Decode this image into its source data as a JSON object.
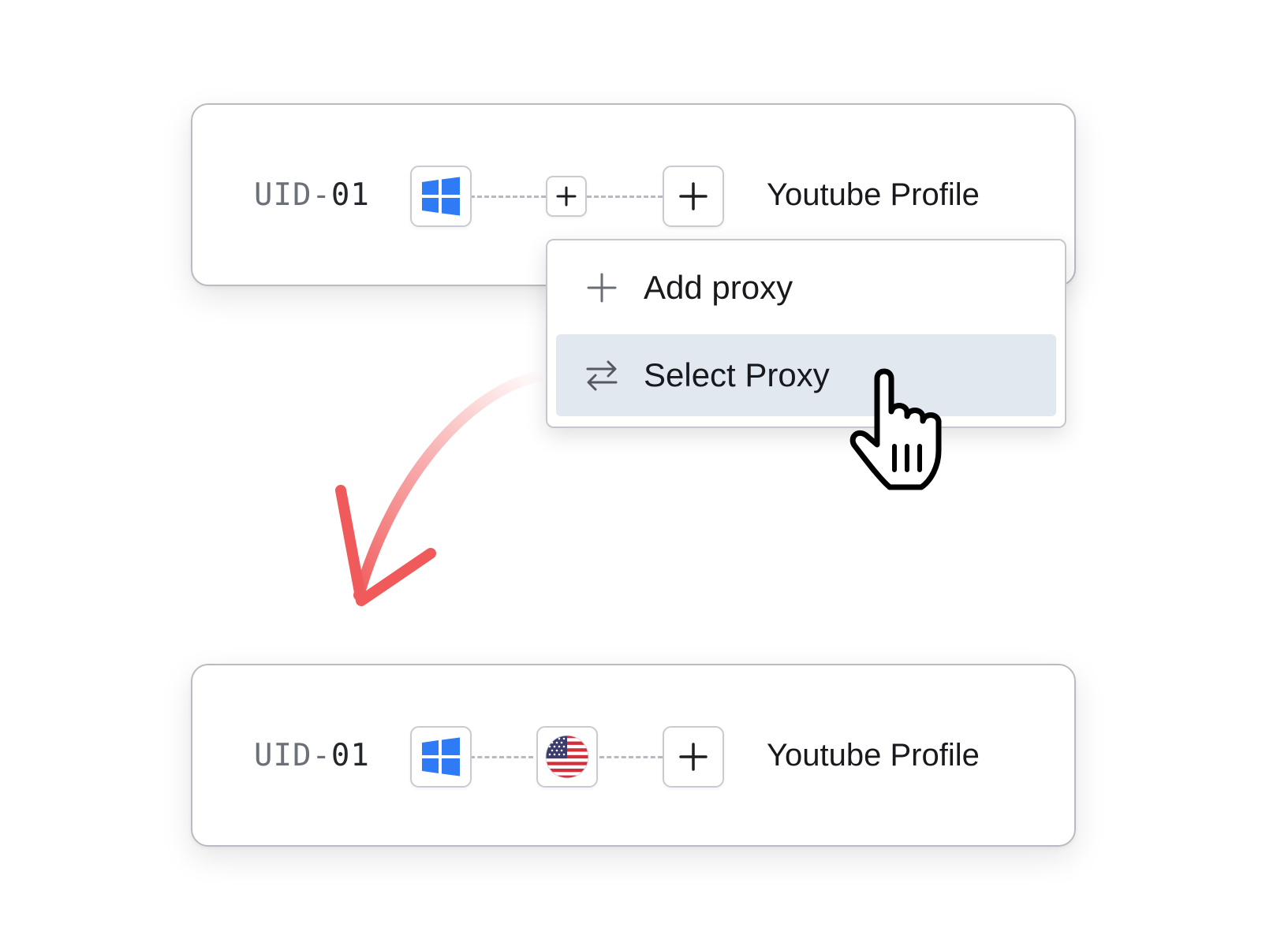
{
  "top_card": {
    "uid_prefix": "UID-",
    "uid_number": "01",
    "os_icon": "windows-icon",
    "proxy_slot_icon": "plus-icon",
    "add_icon": "plus-icon",
    "profile_name": "Youtube Profile"
  },
  "dropdown": {
    "items": [
      {
        "label": "Add proxy",
        "icon": "plus-icon"
      },
      {
        "label": "Select Proxy",
        "icon": "swap-arrows-icon",
        "highlighted": true
      }
    ]
  },
  "bottom_card": {
    "uid_prefix": "UID-",
    "uid_number": "01",
    "os_icon": "windows-icon",
    "proxy_icon": "us-flag-icon",
    "add_icon": "plus-icon",
    "profile_name": "Youtube Profile"
  },
  "colors": {
    "windows_blue": "#2f7bf5",
    "arrow_red": "#f05a5a",
    "menu_highlight": "#e2e8f0",
    "card_border": "#b8bcc2"
  }
}
